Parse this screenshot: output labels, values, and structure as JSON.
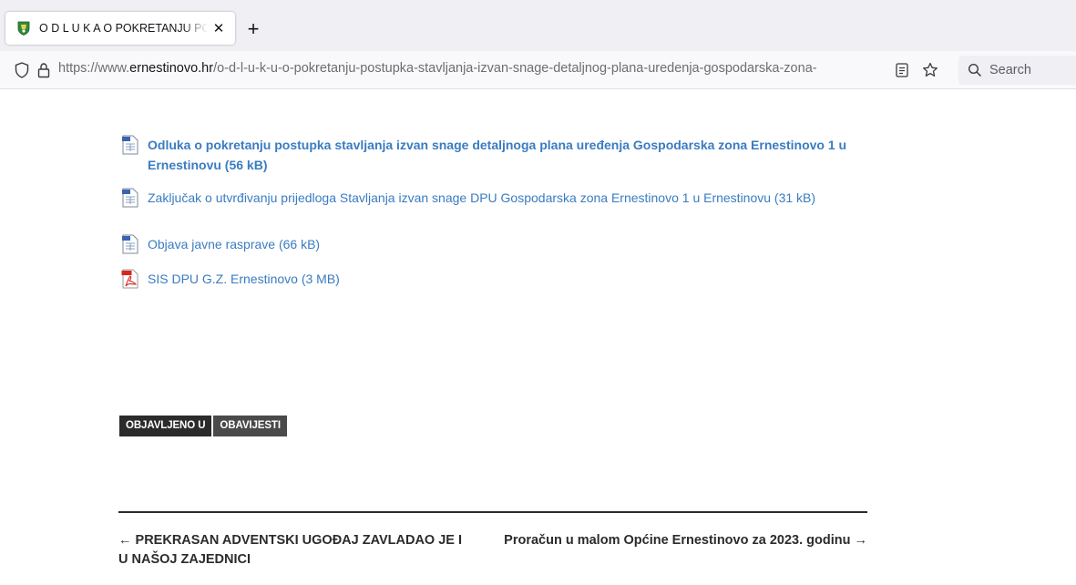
{
  "browser": {
    "tab_title": "O D L U K A O POKRETANJU POSTUPKA STAVLJANJA IZVAN SNAGE",
    "tab_close": "✕",
    "new_tab": "+",
    "url_prefix": "https://www.",
    "url_host": "ernestinovo.hr",
    "url_path": "/o-d-l-u-k-u-o-pokretanju-postupka-stavljanja-izvan-snage-detaljnog-plana-uredenja-gospodarska-zona-",
    "search_label": "Search"
  },
  "attachments": [
    {
      "label": "Odluka o pokretanju postupka stavljanja izvan snage detaljnoga plana uređenja Gospodarska zona Ernestinovo 1 u Ernestinovu (56 kB)",
      "icon": "word-document-icon"
    },
    {
      "label": "Zaključak o utvrđivanju prijedloga Stavljanja izvan snage DPU Gospodarska zona Ernestinovo 1 u Ernestinovu (31 kB)",
      "icon": "word-document-icon"
    },
    {
      "label": "Objava javne rasprave (66 kB)",
      "icon": "word-document-icon"
    },
    {
      "label": "SIS DPU G.Z. Ernestinovo (3 MB)",
      "icon": "pdf-icon"
    }
  ],
  "tags": {
    "label": "OBJAVLJENO U",
    "category": "OBAVIJESTI"
  },
  "post_nav": {
    "prev": "← PREKRASAN ADVENTSKI UGOĐAJ ZAVLADAO JE I U NAŠOJ ZAJEDNICI",
    "next": "Proračun u malom Općine Ernestinovo za 2023. godinu →"
  },
  "colors": {
    "link": "#3a7cc1",
    "tag_dark": "#2b2b2b",
    "tag_mid": "#4a4a4a"
  }
}
